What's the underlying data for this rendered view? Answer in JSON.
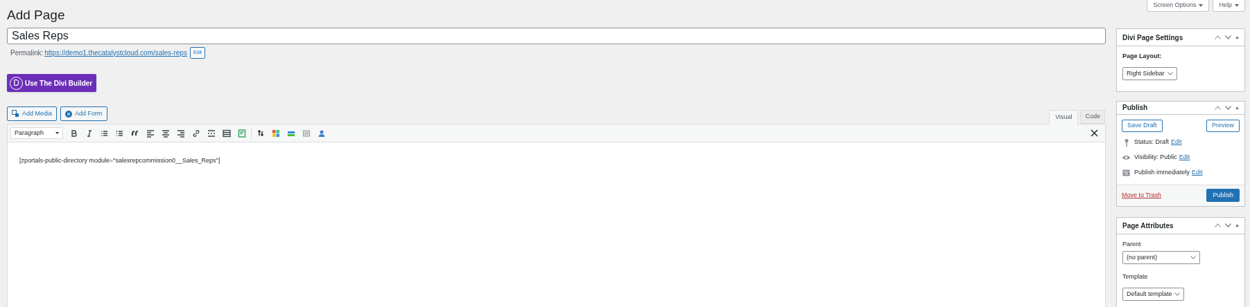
{
  "page_title": "Add Page",
  "screen_meta": [
    {
      "label": "Screen Options"
    },
    {
      "label": "Help"
    }
  ],
  "title_field": {
    "value": "Sales Reps"
  },
  "permalink": {
    "label": "Permalink:",
    "url": "https://demo1.thecatalystcloud.com/sales-reps",
    "edit": "Edit"
  },
  "divi_button": {
    "label": "Use The Divi Builder",
    "logo": "D"
  },
  "media_buttons": [
    {
      "label": "Add Media"
    },
    {
      "label": "Add Form"
    }
  ],
  "editor_tabs": [
    {
      "label": "Visual",
      "selected": true
    },
    {
      "label": "Code",
      "selected": false
    }
  ],
  "format_select": "Paragraph",
  "content": "[zportals-public-directory module=\"salesrepcommission0__Sales_Reps\"]",
  "sidebar": {
    "divi_settings": {
      "title": "Divi Page Settings",
      "layout_label": "Page Layout:",
      "layout_value": "Right Sidebar"
    },
    "publish": {
      "title": "Publish",
      "save_draft": "Save Draft",
      "preview": "Preview",
      "rows": [
        {
          "kind": "status",
          "text": "Status: Draft",
          "link": "Edit"
        },
        {
          "kind": "visibility",
          "text": "Visibility: Public",
          "link": "Edit"
        },
        {
          "kind": "schedule",
          "text": "Publish immediately",
          "link": "Edit"
        }
      ],
      "trash": "Move to Trash",
      "publish_button": "Publish"
    },
    "attributes": {
      "title": "Page Attributes",
      "parent_label": "Parent",
      "parent_value": "(no parent)",
      "template_label": "Template",
      "template_value": "Default template"
    }
  }
}
